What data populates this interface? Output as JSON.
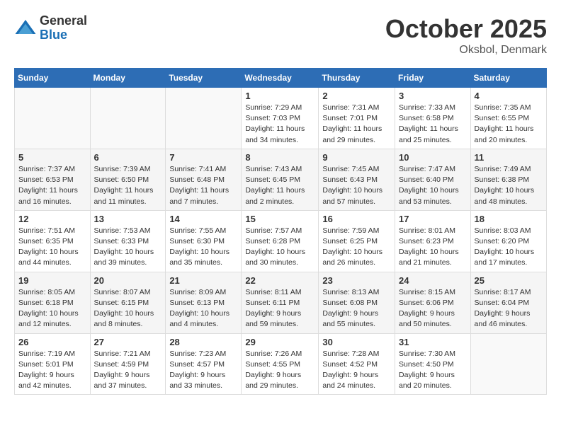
{
  "header": {
    "logo_general": "General",
    "logo_blue": "Blue",
    "title": "October 2025",
    "location": "Oksbol, Denmark"
  },
  "weekdays": [
    "Sunday",
    "Monday",
    "Tuesday",
    "Wednesday",
    "Thursday",
    "Friday",
    "Saturday"
  ],
  "weeks": [
    [
      {
        "day": "",
        "info": ""
      },
      {
        "day": "",
        "info": ""
      },
      {
        "day": "",
        "info": ""
      },
      {
        "day": "1",
        "info": "Sunrise: 7:29 AM\nSunset: 7:03 PM\nDaylight: 11 hours\nand 34 minutes."
      },
      {
        "day": "2",
        "info": "Sunrise: 7:31 AM\nSunset: 7:01 PM\nDaylight: 11 hours\nand 29 minutes."
      },
      {
        "day": "3",
        "info": "Sunrise: 7:33 AM\nSunset: 6:58 PM\nDaylight: 11 hours\nand 25 minutes."
      },
      {
        "day": "4",
        "info": "Sunrise: 7:35 AM\nSunset: 6:55 PM\nDaylight: 11 hours\nand 20 minutes."
      }
    ],
    [
      {
        "day": "5",
        "info": "Sunrise: 7:37 AM\nSunset: 6:53 PM\nDaylight: 11 hours\nand 16 minutes."
      },
      {
        "day": "6",
        "info": "Sunrise: 7:39 AM\nSunset: 6:50 PM\nDaylight: 11 hours\nand 11 minutes."
      },
      {
        "day": "7",
        "info": "Sunrise: 7:41 AM\nSunset: 6:48 PM\nDaylight: 11 hours\nand 7 minutes."
      },
      {
        "day": "8",
        "info": "Sunrise: 7:43 AM\nSunset: 6:45 PM\nDaylight: 11 hours\nand 2 minutes."
      },
      {
        "day": "9",
        "info": "Sunrise: 7:45 AM\nSunset: 6:43 PM\nDaylight: 10 hours\nand 57 minutes."
      },
      {
        "day": "10",
        "info": "Sunrise: 7:47 AM\nSunset: 6:40 PM\nDaylight: 10 hours\nand 53 minutes."
      },
      {
        "day": "11",
        "info": "Sunrise: 7:49 AM\nSunset: 6:38 PM\nDaylight: 10 hours\nand 48 minutes."
      }
    ],
    [
      {
        "day": "12",
        "info": "Sunrise: 7:51 AM\nSunset: 6:35 PM\nDaylight: 10 hours\nand 44 minutes."
      },
      {
        "day": "13",
        "info": "Sunrise: 7:53 AM\nSunset: 6:33 PM\nDaylight: 10 hours\nand 39 minutes."
      },
      {
        "day": "14",
        "info": "Sunrise: 7:55 AM\nSunset: 6:30 PM\nDaylight: 10 hours\nand 35 minutes."
      },
      {
        "day": "15",
        "info": "Sunrise: 7:57 AM\nSunset: 6:28 PM\nDaylight: 10 hours\nand 30 minutes."
      },
      {
        "day": "16",
        "info": "Sunrise: 7:59 AM\nSunset: 6:25 PM\nDaylight: 10 hours\nand 26 minutes."
      },
      {
        "day": "17",
        "info": "Sunrise: 8:01 AM\nSunset: 6:23 PM\nDaylight: 10 hours\nand 21 minutes."
      },
      {
        "day": "18",
        "info": "Sunrise: 8:03 AM\nSunset: 6:20 PM\nDaylight: 10 hours\nand 17 minutes."
      }
    ],
    [
      {
        "day": "19",
        "info": "Sunrise: 8:05 AM\nSunset: 6:18 PM\nDaylight: 10 hours\nand 12 minutes."
      },
      {
        "day": "20",
        "info": "Sunrise: 8:07 AM\nSunset: 6:15 PM\nDaylight: 10 hours\nand 8 minutes."
      },
      {
        "day": "21",
        "info": "Sunrise: 8:09 AM\nSunset: 6:13 PM\nDaylight: 10 hours\nand 4 minutes."
      },
      {
        "day": "22",
        "info": "Sunrise: 8:11 AM\nSunset: 6:11 PM\nDaylight: 9 hours\nand 59 minutes."
      },
      {
        "day": "23",
        "info": "Sunrise: 8:13 AM\nSunset: 6:08 PM\nDaylight: 9 hours\nand 55 minutes."
      },
      {
        "day": "24",
        "info": "Sunrise: 8:15 AM\nSunset: 6:06 PM\nDaylight: 9 hours\nand 50 minutes."
      },
      {
        "day": "25",
        "info": "Sunrise: 8:17 AM\nSunset: 6:04 PM\nDaylight: 9 hours\nand 46 minutes."
      }
    ],
    [
      {
        "day": "26",
        "info": "Sunrise: 7:19 AM\nSunset: 5:01 PM\nDaylight: 9 hours\nand 42 minutes."
      },
      {
        "day": "27",
        "info": "Sunrise: 7:21 AM\nSunset: 4:59 PM\nDaylight: 9 hours\nand 37 minutes."
      },
      {
        "day": "28",
        "info": "Sunrise: 7:23 AM\nSunset: 4:57 PM\nDaylight: 9 hours\nand 33 minutes."
      },
      {
        "day": "29",
        "info": "Sunrise: 7:26 AM\nSunset: 4:55 PM\nDaylight: 9 hours\nand 29 minutes."
      },
      {
        "day": "30",
        "info": "Sunrise: 7:28 AM\nSunset: 4:52 PM\nDaylight: 9 hours\nand 24 minutes."
      },
      {
        "day": "31",
        "info": "Sunrise: 7:30 AM\nSunset: 4:50 PM\nDaylight: 9 hours\nand 20 minutes."
      },
      {
        "day": "",
        "info": ""
      }
    ]
  ]
}
